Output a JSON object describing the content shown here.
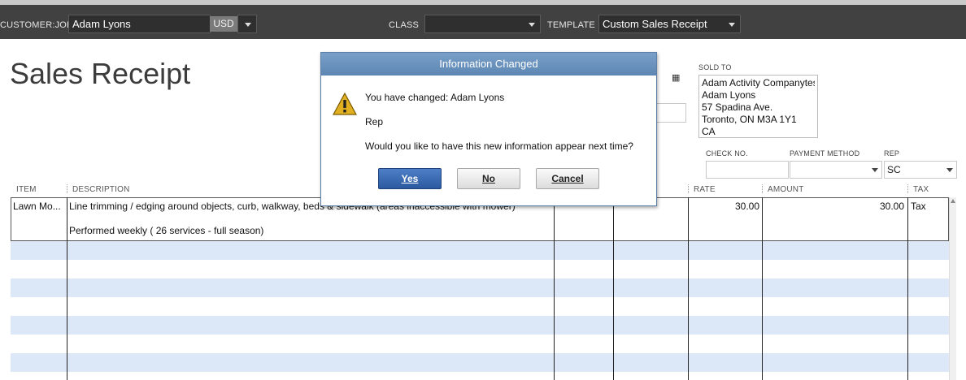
{
  "toolbar": {
    "customer_job_label": "CUSTOMER:JOB",
    "customer_job_value": "Adam Lyons",
    "currency": "USD",
    "class_label": "CLASS",
    "class_value": "",
    "template_label": "TEMPLATE",
    "template_value": "Custom Sales Receipt"
  },
  "form": {
    "title": "Sales Receipt",
    "sold_to_label": "SOLD TO",
    "sold_to_lines": [
      "Adam Activity Companytes",
      "Adam Lyons",
      "57 Spadina Ave.",
      "Toronto, ON M3A 1Y1",
      "CA"
    ],
    "check_no_label": "CHECK NO.",
    "check_no_value": "",
    "payment_method_label": "PAYMENT METHOD",
    "payment_method_value": "",
    "rep_label": "REP",
    "rep_value": "SC"
  },
  "table": {
    "headers": {
      "item": "ITEM",
      "description": "DESCRIPTION",
      "rate": "RATE",
      "amount": "AMOUNT",
      "tax": "TAX"
    },
    "rows": [
      {
        "item": "Lawn Mo...",
        "description_line1": "Line trimming / edging around objects, curb, walkway, beds & sidewalk (areas inaccessible with mower)",
        "description_line2": "Performed weekly ( 26 services - full season)",
        "rate": "30.00",
        "amount": "30.00",
        "tax": "Tax"
      }
    ]
  },
  "dialog": {
    "title": "Information Changed",
    "message_line1": "You have changed: Adam Lyons",
    "message_line2": "Rep",
    "message_line3": "Would you like to have this new information appear next time?",
    "yes_label": "Yes",
    "no_label": "No",
    "cancel_label": "Cancel",
    "icon": "warning-icon"
  },
  "colors": {
    "toolbar_bg": "#414141",
    "stripe": "#dce8f7",
    "dialog_title": "#6b93be",
    "yes_button": "#3a6bb5"
  }
}
